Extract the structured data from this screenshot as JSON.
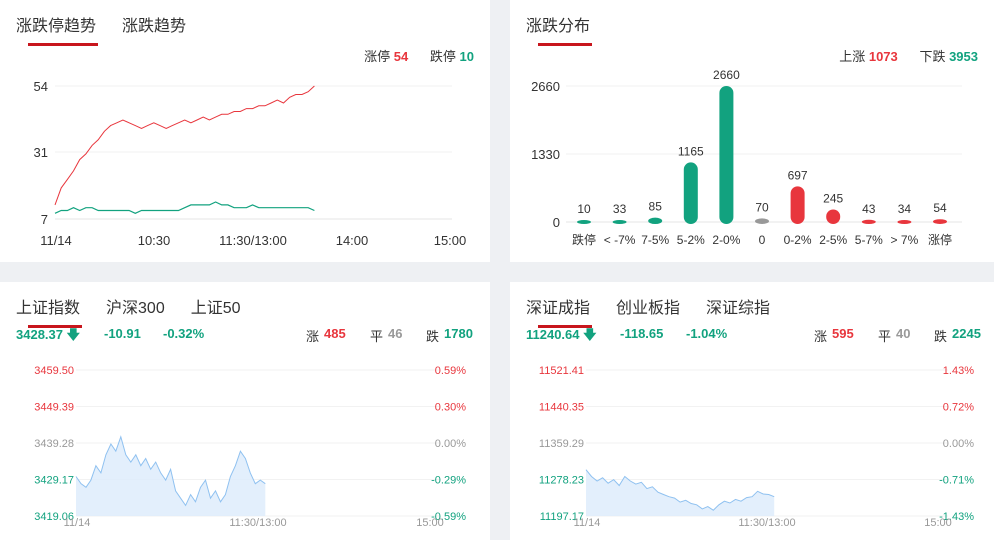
{
  "limit_trend": {
    "tabs": [
      "涨跌停趋势",
      "涨跌趋势"
    ],
    "legend": {
      "up_label": "涨停",
      "up_value": "54",
      "down_label": "跌停",
      "down_value": "10"
    },
    "y_ticks": [
      "54",
      "31",
      "7"
    ],
    "x_ticks": [
      "11/14",
      "10:30",
      "11:30/13:00",
      "14:00",
      "15:00"
    ]
  },
  "distribution": {
    "tabs": [
      "涨跌分布"
    ],
    "legend": {
      "up_label": "上涨",
      "up_value": "1073",
      "down_label": "下跌",
      "down_value": "3953"
    },
    "y_ticks": [
      "2660",
      "1330",
      "0"
    ]
  },
  "sh_index": {
    "tabs": [
      "上证指数",
      "沪深300",
      "上证50"
    ],
    "price": "3428.37",
    "change": "-10.91",
    "change_pct": "-0.32%",
    "up_label": "涨",
    "up_value": "485",
    "flat_label": "平",
    "flat_value": "46",
    "down_label": "跌",
    "down_value": "1780",
    "left_ticks": [
      "3459.50",
      "3449.39",
      "3439.28",
      "3429.17",
      "3419.06"
    ],
    "right_ticks": [
      "0.59%",
      "0.30%",
      "0.00%",
      "-0.29%",
      "-0.59%"
    ],
    "x_ticks": [
      "11/14",
      "11:30/13:00",
      "15:00"
    ]
  },
  "sz_index": {
    "tabs": [
      "深证成指",
      "创业板指",
      "深证综指"
    ],
    "price": "11240.64",
    "change": "-118.65",
    "change_pct": "-1.04%",
    "up_label": "涨",
    "up_value": "595",
    "flat_label": "平",
    "flat_value": "40",
    "down_label": "跌",
    "down_value": "2245",
    "left_ticks": [
      "11521.41",
      "11440.35",
      "11359.29",
      "11278.23",
      "11197.17"
    ],
    "right_ticks": [
      "1.43%",
      "0.72%",
      "0.00%",
      "-0.71%",
      "-1.43%"
    ],
    "x_ticks": [
      "11/14",
      "11:30/13:00",
      "15:00"
    ]
  },
  "colors": {
    "up": "#e8363d",
    "down": "#12a27f",
    "neutral": "#999999",
    "accent": "#c8161d",
    "area": "#dcebfb",
    "area_line": "#8fc1f0"
  },
  "chart_data": [
    {
      "type": "line",
      "title": "涨跌停趋势",
      "ylim": [
        7,
        54
      ],
      "series": [
        {
          "name": "涨停",
          "values": [
            12,
            18,
            21,
            24,
            28,
            30,
            33,
            35,
            38,
            40,
            41,
            42,
            41,
            40,
            39,
            40,
            41,
            40,
            39,
            40,
            41,
            42,
            41,
            42,
            43,
            42,
            43,
            44,
            44,
            45,
            45,
            46,
            46,
            47,
            47,
            48,
            49,
            48,
            50,
            51,
            51,
            52,
            54
          ]
        },
        {
          "name": "跌停",
          "values": [
            9,
            10,
            10,
            11,
            10,
            11,
            11,
            10,
            10,
            10,
            10,
            10,
            10,
            9,
            10,
            10,
            10,
            10,
            10,
            10,
            10,
            11,
            12,
            12,
            12,
            12,
            13,
            12,
            12,
            11,
            11,
            11,
            12,
            11,
            11,
            11,
            11,
            11,
            11,
            11,
            11,
            11,
            10
          ]
        }
      ]
    },
    {
      "type": "bar",
      "title": "涨跌分布",
      "categories": [
        "跌停",
        "< -7%",
        "7-5%",
        "5-2%",
        "2-0%",
        "0",
        "0-2%",
        "2-5%",
        "5-7%",
        "> 7%",
        "涨停"
      ],
      "values": [
        10,
        33,
        85,
        1165,
        2660,
        70,
        697,
        245,
        43,
        34,
        54
      ],
      "ylim": [
        0,
        2660
      ]
    },
    {
      "type": "area",
      "title": "上证指数",
      "ylim": [
        3419.06,
        3459.5
      ],
      "values": [
        3430,
        3428,
        3427,
        3429,
        3433,
        3431,
        3436,
        3439,
        3437,
        3441,
        3436,
        3434,
        3436,
        3433,
        3435,
        3432,
        3434,
        3431,
        3429,
        3432,
        3426,
        3424,
        3422,
        3425,
        3423,
        3427,
        3429,
        3424,
        3426,
        3423,
        3425,
        3430,
        3433,
        3437,
        3435,
        3431,
        3428,
        3429,
        3428
      ]
    },
    {
      "type": "area",
      "title": "深证成指",
      "ylim": [
        11197.17,
        11521.41
      ],
      "values": [
        11300,
        11285,
        11275,
        11282,
        11270,
        11278,
        11265,
        11285,
        11275,
        11268,
        11272,
        11258,
        11262,
        11250,
        11245,
        11240,
        11237,
        11228,
        11232,
        11225,
        11222,
        11213,
        11218,
        11210,
        11222,
        11230,
        11226,
        11234,
        11230,
        11238,
        11240,
        11252,
        11246,
        11245,
        11240
      ]
    }
  ]
}
